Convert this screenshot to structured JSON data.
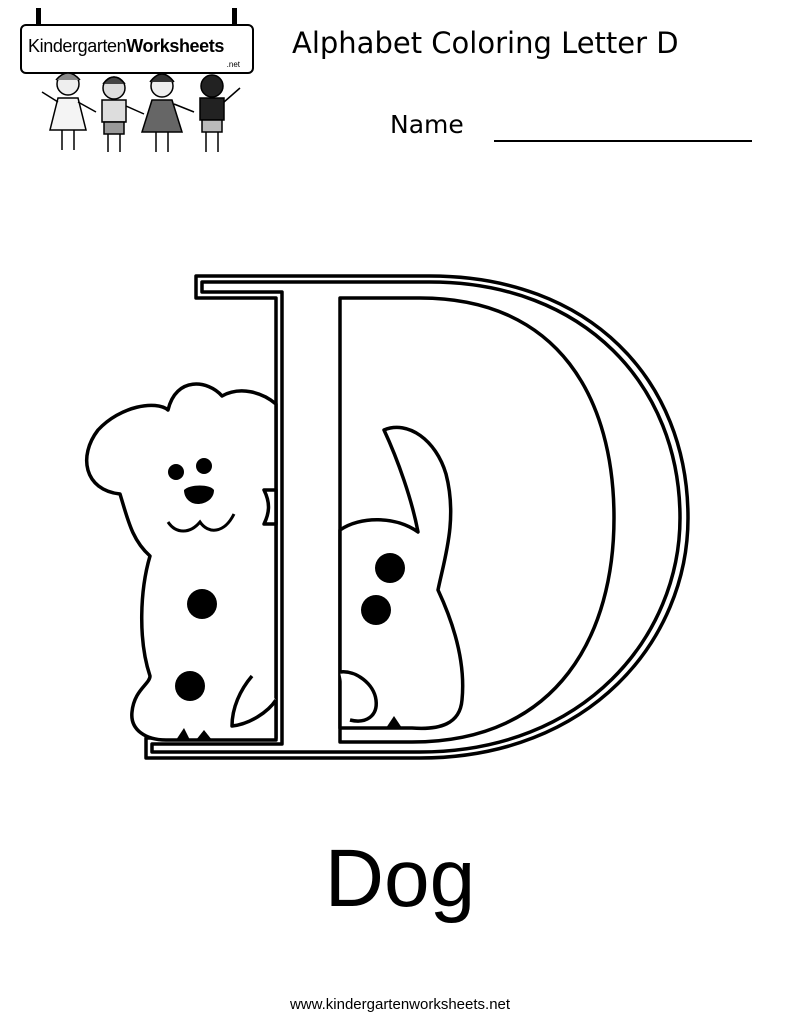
{
  "header": {
    "logo": {
      "part1": "Kindergarten",
      "part2": "Worksheets",
      "suffix": ".net"
    },
    "title": "Alphabet Coloring Letter D",
    "name_label": "Name"
  },
  "main": {
    "letter": "D",
    "picture": "dog-icon",
    "word": "Dog"
  },
  "footer": {
    "url": "www.kindergartenworksheets.net"
  }
}
